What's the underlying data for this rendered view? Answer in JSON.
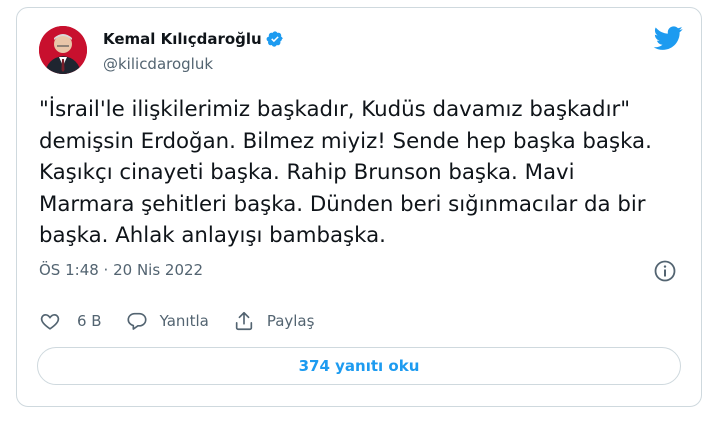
{
  "author": {
    "name": "Kemal Kılıçdaroğlu",
    "handle": "@kilicdarogluk"
  },
  "tweet": {
    "text": "\"İsrail'le ilişkilerimiz başkadır, Kudüs davamız başkadır\"\ndemişsin Erdoğan. Bilmez miyiz! Sende hep başka başka.\nKaşıkçı cinayeti başka. Rahip Brunson başka. Mavi\nMarmara şehitleri başka. Dünden beri sığınmacılar da bir\nbaşka. Ahlak anlayışı bambaşka.",
    "timestamp": "ÖS 1:48 · 20 Nis 2022"
  },
  "actions": {
    "likes": "6 B",
    "reply": "Yanıtla",
    "share": "Paylaş"
  },
  "read_replies": "374 yanıtı oku",
  "colors": {
    "accent": "#1d9bf0",
    "text": "#0f1419",
    "secondary": "#536471",
    "border": "#cfd9de"
  },
  "icons": [
    "verified-badge-icon",
    "twitter-bird-icon",
    "info-icon",
    "heart-icon",
    "reply-icon",
    "share-icon"
  ]
}
